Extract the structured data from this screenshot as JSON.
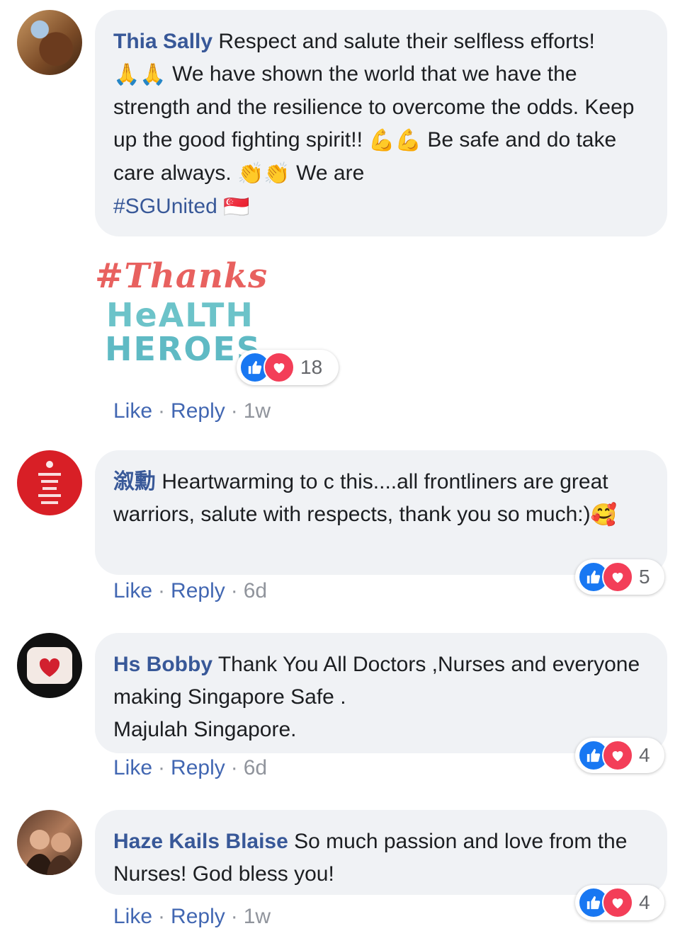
{
  "comments": [
    {
      "name": "Thia Sally",
      "text_1": "Respect and salute their selfless efforts!",
      "text_2": "We have shown the world that we have the strength and the resilience to overcome the odds. Keep up the good fighting spirit!!",
      "text_3": "Be safe and do take care always.",
      "text_4": "We are",
      "hashtag": "#SGUnited",
      "emoji_1": "🙏🙏",
      "emoji_2": "💪💪",
      "emoji_3": "👏👏",
      "emoji_4": "🇸🇬",
      "sticker": {
        "line1": "#Thanks",
        "line2": "HeALTH",
        "line3": "HEROES"
      },
      "reaction_count": "18",
      "like": "Like",
      "reply": "Reply",
      "time": "1w"
    },
    {
      "name": "溆勳",
      "text": "Heartwarming to c this....all frontliners are great warriors, salute with respects, thank you so much:)",
      "emoji": "🥰",
      "avatar_text": "KEEP CALM AND STAY AT HOME",
      "reaction_count": "5",
      "like": "Like",
      "reply": "Reply",
      "time": "6d"
    },
    {
      "name": "Hs Bobby",
      "text": "Thank You All Doctors ,Nurses and everyone making Singapore Safe .",
      "text_2": "Majulah Singapore.",
      "reaction_count": "4",
      "like": "Like",
      "reply": "Reply",
      "time": "6d"
    },
    {
      "name": "Haze Kails Blaise",
      "text": "So much passion and love from the Nurses! God bless you!",
      "reaction_count": "4",
      "like": "Like",
      "reply": "Reply",
      "time": "1w"
    }
  ],
  "separator": "·",
  "colors": {
    "name": "#385898",
    "bubble": "#f0f2f5",
    "like": "#1877f2",
    "love": "#f33e58"
  }
}
